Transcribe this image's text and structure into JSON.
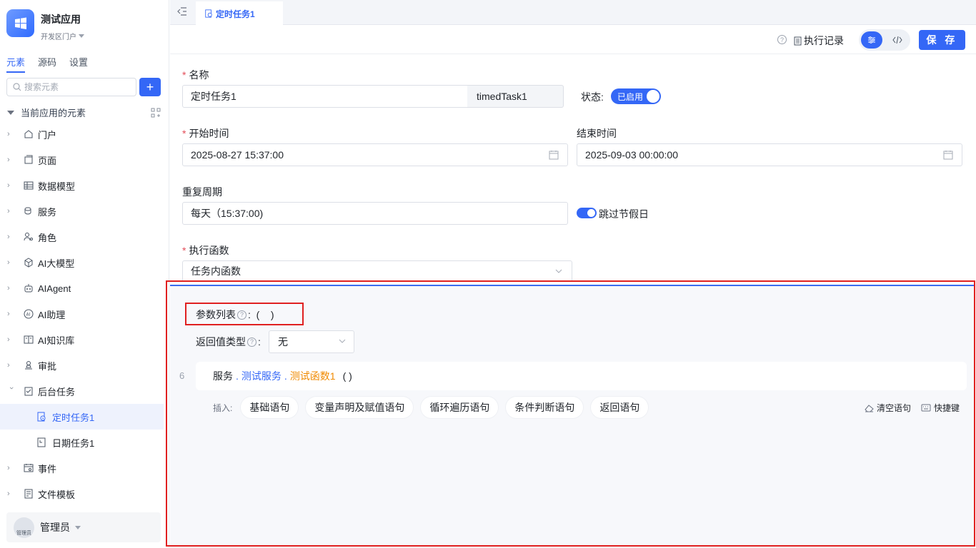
{
  "app": {
    "name": "测试应用",
    "env": "开发区门户"
  },
  "side_tabs": [
    "元素",
    "源码",
    "设置"
  ],
  "search": {
    "placeholder": "搜索元素"
  },
  "tree_root": "当前应用的元素",
  "tree": [
    {
      "label": "门户",
      "icon": "home-icon"
    },
    {
      "label": "页面",
      "icon": "page-icon"
    },
    {
      "label": "数据模型",
      "icon": "table-icon"
    },
    {
      "label": "服务",
      "icon": "service-icon"
    },
    {
      "label": "角色",
      "icon": "role-icon"
    },
    {
      "label": "AI大模型",
      "icon": "cube-icon"
    },
    {
      "label": "AIAgent",
      "icon": "robot-icon"
    },
    {
      "label": "AI助理",
      "icon": "ai-icon"
    },
    {
      "label": "AI知识库",
      "icon": "book-icon"
    },
    {
      "label": "审批",
      "icon": "stamp-icon"
    },
    {
      "label": "后台任务",
      "icon": "task-icon"
    },
    {
      "label": "定时任务1",
      "icon": "timer-task-icon"
    },
    {
      "label": "日期任务1",
      "icon": "calendar-task-icon"
    },
    {
      "label": "事件",
      "icon": "event-icon"
    },
    {
      "label": "文件模板",
      "icon": "file-template-icon"
    }
  ],
  "user": {
    "name": "管理员",
    "avatar_text": "管理员"
  },
  "doc_tab": "定时任务1",
  "toolbar": {
    "log": "执行记录",
    "save": "保 存"
  },
  "form": {
    "name_label": "名称",
    "name_value": "定时任务1",
    "code_value": "timedTask1",
    "status_label": "状态:",
    "status_value": "已启用",
    "start_label": "开始时间",
    "start_value": "2025-08-27 15:37:00",
    "end_label": "结束时间",
    "end_value": "2025-09-03 00:00:00",
    "repeat_label": "重复周期",
    "repeat_value": "每天（15:37:00)",
    "skip_holiday": "跳过节假日",
    "func_label": "执行函数",
    "func_value": "任务内函数"
  },
  "editor": {
    "params_label": "参数列表",
    "params_value": "(    )",
    "return_label": "返回值类型",
    "return_value": "无",
    "line_number": "6",
    "code": {
      "a": "服务",
      "dot1": ".",
      "b": "测试服务",
      "dot2": ".",
      "c": "测试函数1",
      "paren": "( )"
    },
    "insert_label": "插入:",
    "insert_buttons": [
      "基础语句",
      "变量声明及赋值语句",
      "循环遍历语句",
      "条件判断语句",
      "返回语句"
    ],
    "clear": "清空语句",
    "shortcut": "快捷键"
  }
}
